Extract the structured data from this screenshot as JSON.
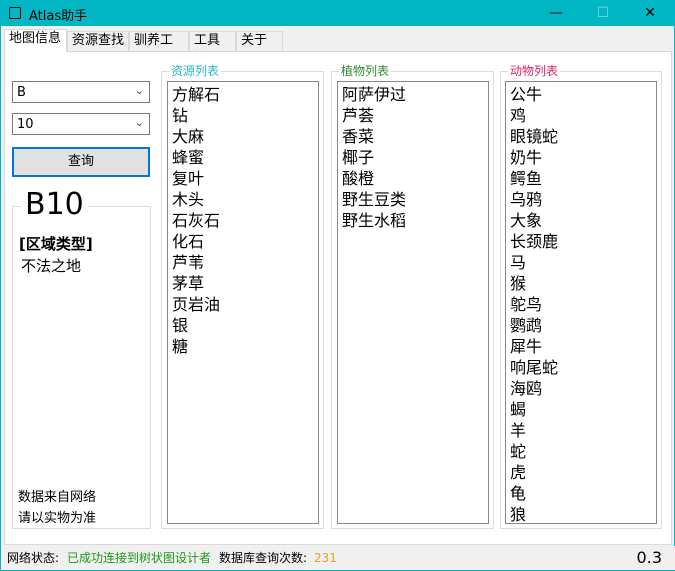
{
  "window": {
    "title": "Atlas助手",
    "minimize": "—",
    "maximize": "☐",
    "close": "✕"
  },
  "tabs": [
    {
      "label": "地图信息",
      "active": true
    },
    {
      "label": "资源查找"
    },
    {
      "label": "驯养工具"
    },
    {
      "label": "工具箱"
    },
    {
      "label": "关于"
    }
  ],
  "left": {
    "combo1": "B",
    "combo2": "10",
    "query_label": "查询",
    "region_code": "B10",
    "region_type_label": "[区域类型]",
    "region_type": "不法之地",
    "note1": "数据来自网络",
    "note2": "请以实物为准"
  },
  "resources": {
    "title": "资源列表",
    "color": "#2cb6c8",
    "items": [
      "方解石",
      "钻",
      "大麻",
      "蜂蜜",
      "复叶",
      "木头",
      "石灰石",
      "化石",
      "芦苇",
      "茅草",
      "页岩油",
      "银",
      "糖"
    ]
  },
  "plants": {
    "title": "植物列表",
    "color": "#2e8b2e",
    "items": [
      "阿萨伊过",
      "芦荟",
      "香菜",
      "椰子",
      "酸橙",
      "野生豆类",
      "野生水稻"
    ]
  },
  "animals": {
    "title": "动物列表",
    "color": "#e0245e",
    "items": [
      "公牛",
      "鸡",
      "眼镜蛇",
      "奶牛",
      "鳄鱼",
      "乌鸦",
      "大象",
      "长颈鹿",
      "马",
      "猴",
      "鸵鸟",
      "鹦鹉",
      "犀牛",
      "响尾蛇",
      "海鸥",
      "蝎",
      "羊",
      "蛇",
      "虎",
      "龟",
      "狼"
    ]
  },
  "status": {
    "network_label": "网络状态:",
    "network_value": "已成功连接到树状图设计者",
    "network_color": "#1a9a1a",
    "query_label": "数据库查询次数:",
    "query_count": "231",
    "count_color": "#e0a030",
    "version": "0.3"
  }
}
